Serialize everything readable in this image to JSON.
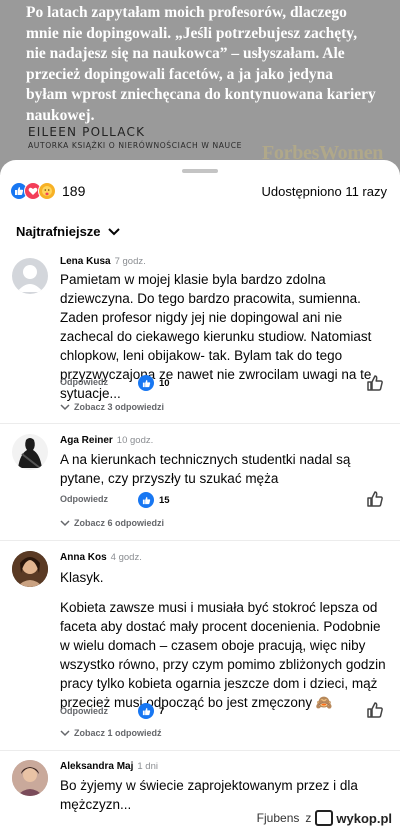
{
  "quote": {
    "text": "Po latach zapytałam moich profesorów, dlaczego mnie nie dopingowali. „Jeśli potrzebujesz zachęty, nie nadajesz się na naukowca” – usłyszałam. Ale przecież dopingowali facetów, a ja jako jedyna byłam wprost zniechęcana do kontynuowana kariery naukowej.",
    "author": "EILEEN POLLACK",
    "role": "AUTORKA KSIĄŻKI O NIERÓWNOŚCIACH W NAUCE",
    "brand": "ForbesWomen"
  },
  "reactions": {
    "count": "189",
    "types": [
      "like-icon",
      "love-icon",
      "care-icon"
    ]
  },
  "shares": "Udostępniono 11 razy",
  "sort_label": "Najtrafniejsze",
  "reply_label": "Odpowiedz",
  "comments": [
    {
      "author": "Lena  Kusa",
      "time": "7 godz.",
      "text": "Pamietam w mojej klasie byla bardzo zdolna dziewczyna. Do tego bardzo pracowita, sumienna. Zaden profesor nigdy jej nie dopingowal ani nie zachecal do ciekawego kierunku studiow. Natomiast chlopkow, leni obijakow- tak. Bylam tak do tego przyzwyczajona ze nawet nie zwrocilam uwagi na te sytuacje...",
      "likes": "10",
      "replies": "Zobacz 3 odpowiedzi"
    },
    {
      "author": "Aga Reiner",
      "time": "10 godz.",
      "text": "A na kierunkach technicznych studentki nadal są pytane, czy przyszły tu szukać męża",
      "likes": "15",
      "replies": "Zobacz 6 odpowiedzi"
    },
    {
      "author": "Anna Kos",
      "time": "4 godz.",
      "text1": "Klasyk.",
      "text2": "Kobieta zawsze musi i musiała być stokroć lepsza od faceta aby dostać mały procent docenienia. Podobnie w wielu domach – czasem oboje pracują, więc niby wszystko równo, przy czym pomimo zbliżonych godzin pracy tylko kobieta ogarnia jeszcze dom i dzieci, mąż przecież musi odpocząć bo jest zmęczony 🙈",
      "likes": "7",
      "replies": "Zobacz 1 odpowiedź"
    },
    {
      "author": "Aleksandra Maj",
      "time": "1 dni",
      "text": "Bo żyjemy w świecie zaprojektowanym przez i dla mężczyzn..."
    }
  ],
  "footer": {
    "user": "Fjubens",
    "z": "z",
    "site": "wykop.pl"
  }
}
